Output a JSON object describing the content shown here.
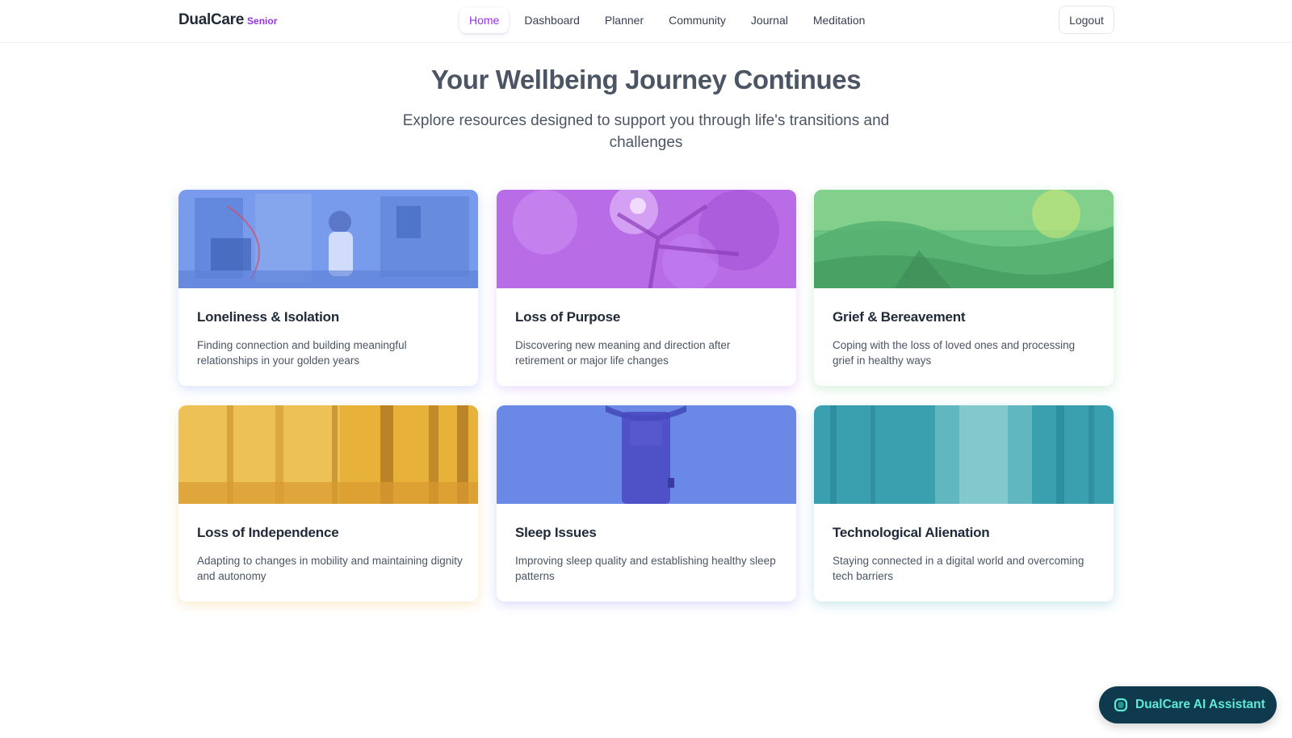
{
  "header": {
    "brand_name": "DualCare",
    "brand_tag": "Senior",
    "nav": [
      {
        "label": "Home",
        "active": true
      },
      {
        "label": "Dashboard",
        "active": false
      },
      {
        "label": "Planner",
        "active": false
      },
      {
        "label": "Community",
        "active": false
      },
      {
        "label": "Journal",
        "active": false
      },
      {
        "label": "Meditation",
        "active": false
      }
    ],
    "logout_label": "Logout"
  },
  "hero": {
    "title": "Your Wellbeing Journey Continues",
    "subtitle": "Explore resources designed to support you through life's transitions and challenges"
  },
  "cards": [
    {
      "title": "Loneliness & Isolation",
      "description": "Finding connection and building meaningful relationships in your golden years",
      "accent": "#5b8ef0"
    },
    {
      "title": "Loss of Purpose",
      "description": "Discovering new meaning and direction after retirement or major life changes",
      "accent": "#b06ee8"
    },
    {
      "title": "Grief & Bereavement",
      "description": "Coping with the loss of loved ones and processing grief in healthy ways",
      "accent": "#5cc07a"
    },
    {
      "title": "Loss of Independence",
      "description": "Adapting to changes in mobility and maintaining dignity and autonomy",
      "accent": "#e5b23c"
    },
    {
      "title": "Sleep Issues",
      "description": "Improving sleep quality and establishing healthy sleep patterns",
      "accent": "#6c88e8"
    },
    {
      "title": "Technological Alienation",
      "description": "Staying connected in a digital world and overcoming tech barriers",
      "accent": "#3a9fb0"
    }
  ],
  "assistant": {
    "label": "DualCare AI Assistant",
    "icon": "chat-bubble-icon"
  }
}
